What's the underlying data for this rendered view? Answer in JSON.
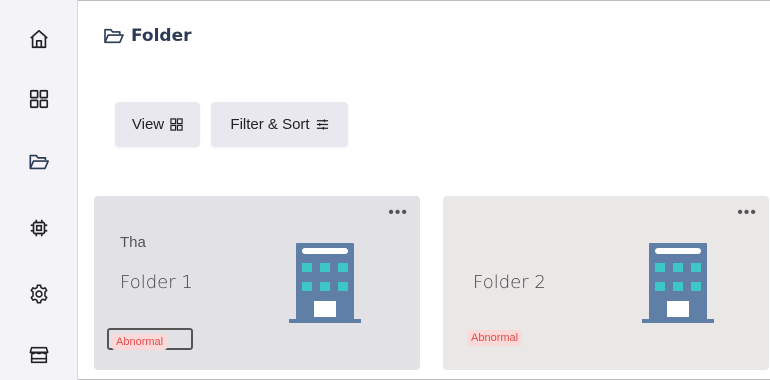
{
  "sidebar": {
    "items": [
      {
        "icon": "home-icon"
      },
      {
        "icon": "grid-icon"
      },
      {
        "icon": "folder-icon",
        "active": true
      },
      {
        "icon": "chip-icon"
      },
      {
        "icon": "gear-icon"
      },
      {
        "icon": "store-icon"
      }
    ]
  },
  "header": {
    "title": "Folder",
    "icon": "folder-icon"
  },
  "toolbar": {
    "view_label": "View",
    "filter_label": "Filter & Sort"
  },
  "folders": [
    {
      "subtitle": "Tha",
      "name": "Folder 1",
      "status": "Abnormal",
      "menu": "•••"
    },
    {
      "subtitle": "",
      "name": "Folder 2",
      "status": "Abnormal",
      "menu": "•••"
    }
  ],
  "colors": {
    "building": "#5f7fa6",
    "window": "#3ec6c6",
    "status_bg": "#fbd9d9",
    "status_text": "#e24c4c"
  }
}
